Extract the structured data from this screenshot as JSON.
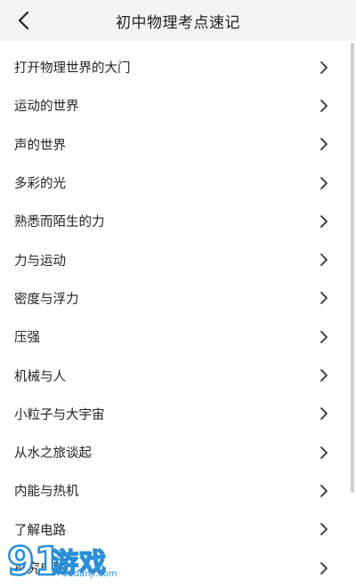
{
  "header": {
    "title": "初中物理考点速记",
    "back_icon": "chevron-left-icon"
  },
  "topics": [
    {
      "label": "打开物理世界的大门"
    },
    {
      "label": "运动的世界"
    },
    {
      "label": "声的世界"
    },
    {
      "label": "多彩的光"
    },
    {
      "label": "熟悉而陌生的力"
    },
    {
      "label": "力与运动"
    },
    {
      "label": "密度与浮力"
    },
    {
      "label": "压强"
    },
    {
      "label": "机械与人"
    },
    {
      "label": "小粒子与大宇宙"
    },
    {
      "label": "从水之旅谈起"
    },
    {
      "label": "内能与热机"
    },
    {
      "label": "了解电路"
    },
    {
      "label": "探究电路"
    }
  ],
  "row_icon": "chevron-right-icon",
  "watermark": {
    "brand": "游戏",
    "url": "91danji.com",
    "logo_text": "91"
  },
  "colors": {
    "header_bg": "#f3f3f3",
    "text": "#222222",
    "chevron": "#333333",
    "watermark": "#2a8fd8"
  }
}
